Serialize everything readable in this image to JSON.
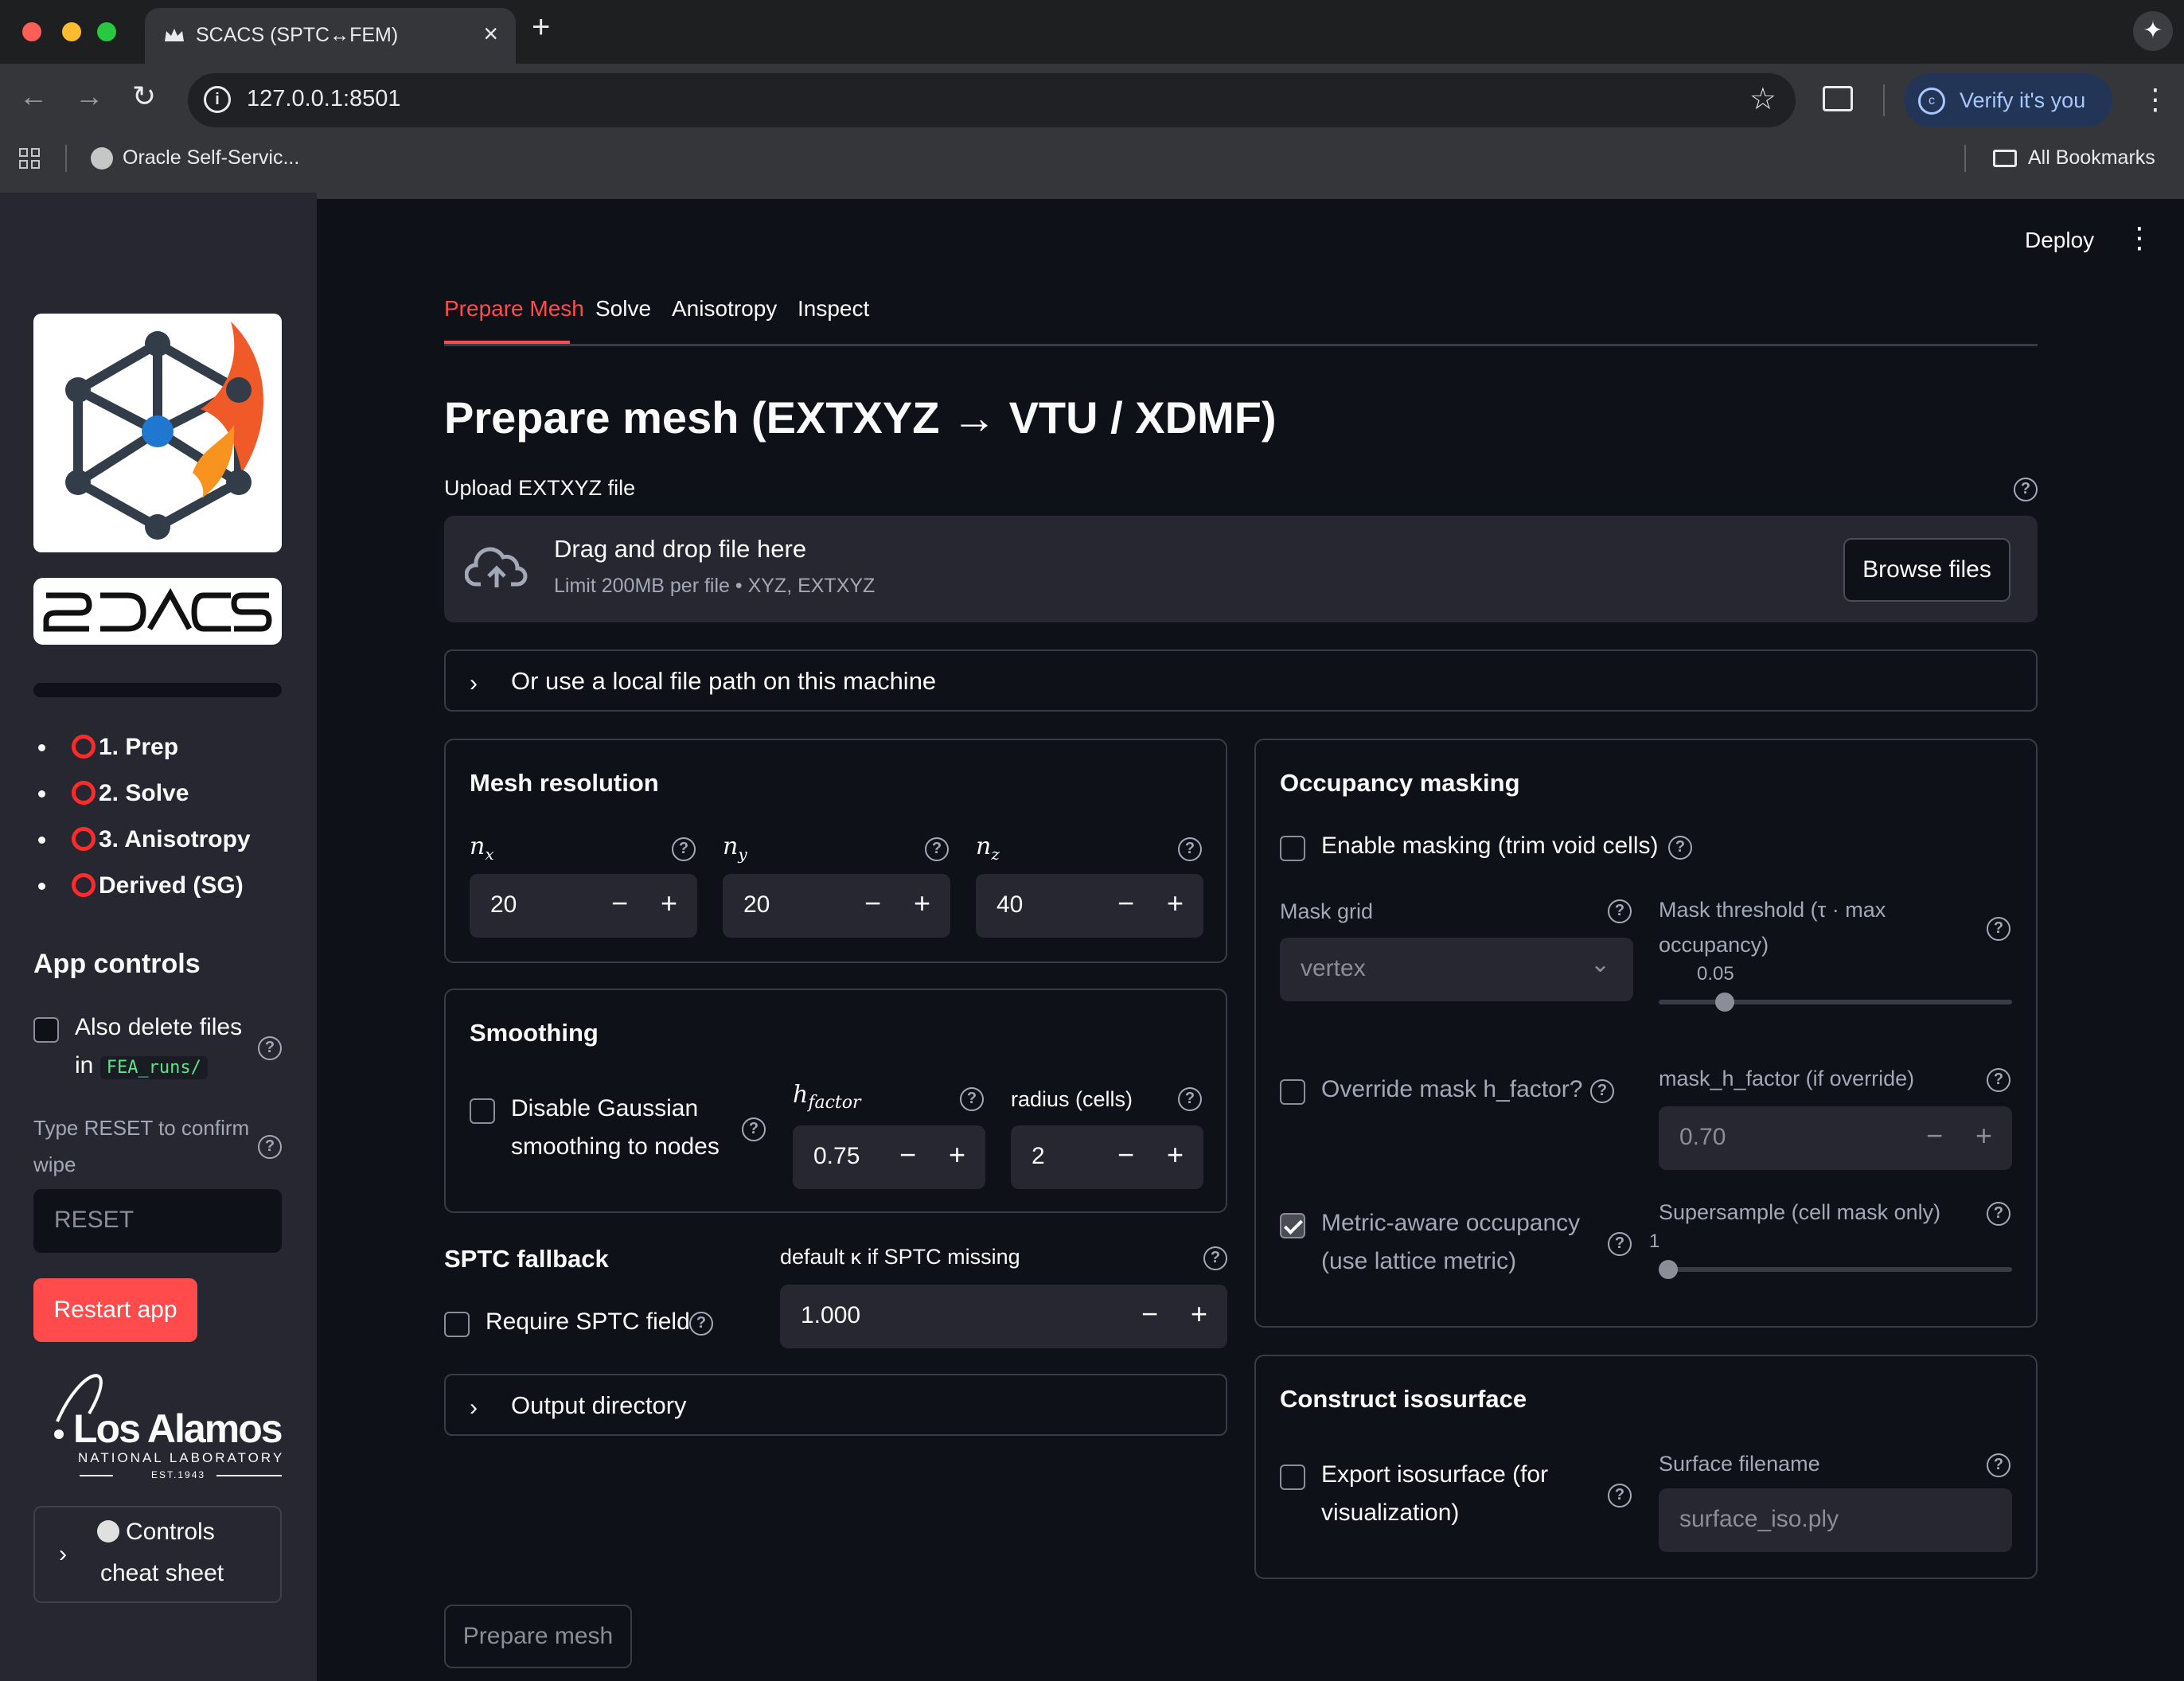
{
  "browser": {
    "tab_title": "SCACS (SPTC↔FEM)",
    "url": "127.0.0.1:8501",
    "verify_label": "Verify it's you",
    "avatar_letter": "c",
    "bookmark_item": "Oracle Self-Servic...",
    "all_bookmarks": "All Bookmarks"
  },
  "header": {
    "deploy_label": "Deploy"
  },
  "sidebar": {
    "logo_text": "SCACS",
    "steps": [
      "1. Prep",
      "2. Solve",
      "3. Anisotropy",
      "Derived (SG)"
    ],
    "app_controls_title": "App controls",
    "also_delete_label_1": "Also delete files",
    "also_delete_label_in": "in",
    "also_delete_code": "FEA_runs/",
    "reset_label_1": "Type RESET to confirm",
    "reset_label_2": "wipe",
    "reset_placeholder": "RESET",
    "restart_label": "Restart app",
    "lanl_name": "Los Alamos",
    "lanl_sub": "NATIONAL LABORATORY",
    "lanl_est": "EST.1943",
    "cheat_line1": "Controls",
    "cheat_line2": "cheat sheet"
  },
  "tabs": [
    "Prepare Mesh",
    "Solve",
    "Anisotropy",
    "Inspect"
  ],
  "active_tab": "Prepare Mesh",
  "main": {
    "title": "Prepare mesh (EXTXYZ → VTU / XDMF)",
    "upload_label": "Upload EXTXYZ file",
    "drop_title": "Drag and drop file here",
    "drop_limit": "Limit 200MB per file • XYZ, EXTXYZ",
    "browse_label": "Browse files",
    "local_path_expander": "Or use a local file path on this machine",
    "prepare_button": "Prepare mesh"
  },
  "mesh_resolution": {
    "title": "Mesh resolution",
    "nx_label": "n",
    "nx_sub": "x",
    "nx_value": "20",
    "ny_label": "n",
    "ny_sub": "y",
    "ny_value": "20",
    "nz_label": "n",
    "nz_sub": "z",
    "nz_value": "40"
  },
  "smoothing": {
    "title": "Smoothing",
    "disable_label_1": "Disable Gaussian",
    "disable_label_2": "smoothing to nodes",
    "hfactor_label": "h",
    "hfactor_sub": "factor",
    "hfactor_value": "0.75",
    "radius_label": "radius (cells)",
    "radius_value": "2"
  },
  "sptc": {
    "title": "SPTC fallback",
    "require_label": "Require SPTC field",
    "default_label": "default κ if SPTC missing",
    "default_value": "1.000"
  },
  "output_dir": {
    "label": "Output directory"
  },
  "occupancy": {
    "title": "Occupancy masking",
    "enable_label": "Enable masking (trim void cells)",
    "mask_grid_label": "Mask grid",
    "mask_grid_value": "vertex",
    "threshold_label_1": "Mask threshold (τ · max",
    "threshold_label_2": "occupancy)",
    "threshold_value": "0.05",
    "threshold_fraction": 0.17,
    "override_label": "Override mask h_factor?",
    "mask_hfactor_label": "mask_h_factor (if override)",
    "mask_hfactor_value": "0.70",
    "metric_label_1": "Metric-aware occupancy",
    "metric_label_2": "(use lattice metric)",
    "metric_checked": true,
    "supersample_label": "Supersample (cell mask only)",
    "supersample_value": "1",
    "supersample_fraction": 0.0
  },
  "isosurface": {
    "title": "Construct isosurface",
    "export_label_1": "Export isosurface (for",
    "export_label_2": "visualization)",
    "filename_label": "Surface filename",
    "filename_value": "surface_iso.ply"
  },
  "icons": [
    "crown-favicon",
    "info-icon",
    "star-icon",
    "lens-icon",
    "gemini-icon",
    "grid-icon",
    "globe-icon",
    "folder-icon",
    "upload-cloud-icon",
    "chevron-right-icon",
    "help-icon",
    "chevron-down-icon",
    "compass-icon"
  ],
  "colors": {
    "accent": "#ff4b4b",
    "bg": "#0e1117",
    "sidebar": "#262730",
    "brand_blue": "#1f77d0",
    "flame": "#f05a28"
  }
}
